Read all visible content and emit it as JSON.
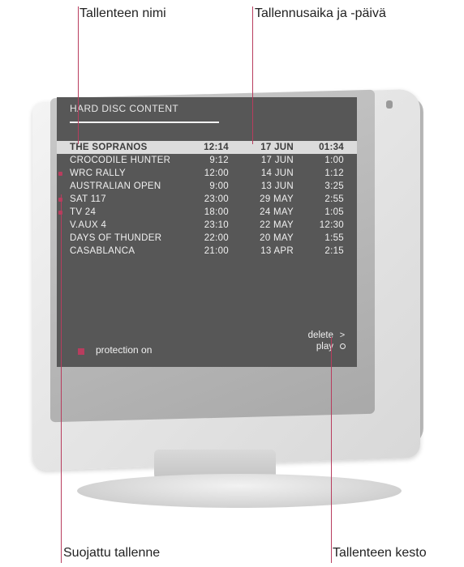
{
  "captions": {
    "top_left": "Tallenteen nimi",
    "top_right": "Tallennusaika ja -päivä",
    "bottom_left": "Suojattu tallenne",
    "bottom_right": "Tallenteen kesto"
  },
  "menu": {
    "title": "HARD DISC CONTENT",
    "recordings": [
      {
        "name": "THE SOPRANOS",
        "time": "12:14",
        "date": "17 JUN",
        "duration": "01:34",
        "protected": false,
        "selected": true
      },
      {
        "name": "CROCODILE HUNTER",
        "time": "9:12",
        "date": "17 JUN",
        "duration": "1:00",
        "protected": false,
        "selected": false
      },
      {
        "name": "WRC RALLY",
        "time": "12:00",
        "date": "14 JUN",
        "duration": "1:12",
        "protected": true,
        "selected": false
      },
      {
        "name": "AUSTRALIAN OPEN",
        "time": "9:00",
        "date": "13 JUN",
        "duration": "3:25",
        "protected": false,
        "selected": false
      },
      {
        "name": "SAT 117",
        "time": "23:00",
        "date": "29 MAY",
        "duration": "2:55",
        "protected": true,
        "selected": false
      },
      {
        "name": "TV 24",
        "time": "18:00",
        "date": "24 MAY",
        "duration": "1:05",
        "protected": true,
        "selected": false
      },
      {
        "name": "V.AUX 4",
        "time": "23:10",
        "date": "22 MAY",
        "duration": "12:30",
        "protected": false,
        "selected": false
      },
      {
        "name": "DAYS OF THUNDER",
        "time": "22:00",
        "date": "20 MAY",
        "duration": "1:55",
        "protected": false,
        "selected": false
      },
      {
        "name": "CASABLANCA",
        "time": "21:00",
        "date": "13 APR",
        "duration": "2:15",
        "protected": false,
        "selected": false
      }
    ],
    "legend": "protection on",
    "actions": {
      "delete": {
        "label": "delete",
        "icon": "chevron-right-icon",
        "glyph": ">"
      },
      "play": {
        "label": "play",
        "icon": "ring-icon"
      }
    }
  },
  "colors": {
    "screen_bg": "#575757",
    "protection_marker": "#b83d5e",
    "callout_line": "#b83d5e",
    "selected_row": "#dcdcdc"
  }
}
